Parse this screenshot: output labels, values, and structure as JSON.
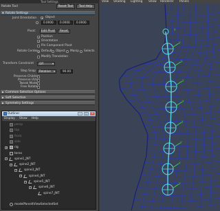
{
  "tool_settings": {
    "window_title": "Tool Settings",
    "tool_name": "Rotate Tool",
    "reset_tool": "Reset Tool",
    "tool_help": "Tool Help",
    "sections": {
      "rotate_settings": "Rotate Settings",
      "common_selection": "Common Selection Options",
      "soft_selection": "Soft Selection",
      "symmetry_settings": "Symmetry Settings"
    },
    "joint_orientation_label": "Joint Orientation",
    "joint_orientation_value": "Object",
    "xyz_values": [
      "0.0000",
      "0.0000",
      "0.0000"
    ],
    "pivot_label": "Pivot:",
    "edit_pivot": "Edit Pivot",
    "reset": "Reset",
    "position_label": "Position",
    "orientation_label": "Orientation",
    "pin_pivot_label": "Pin Component Pivot",
    "rotate_center_label": "Rotate Center",
    "rotate_center_options": [
      "Default",
      "Object",
      "Manip",
      "Selects"
    ],
    "modify_translation_label": "Modify Translation",
    "transform_constraint_label": "Transform Constraint",
    "transform_constraint_value": "Off",
    "step_snap_label": "Step Snap",
    "step_snap_mode": "Relative",
    "step_snap_value": "90.00",
    "preserve_children_label": "Preserve Children",
    "preserve_uvs_label": "Preserve UVs",
    "tweak_mode_label": "Tweak Mode",
    "free_rotate_label": "Free Rotate"
  },
  "outliner": {
    "title": "Outliner",
    "menu": [
      "Display",
      "Show",
      "Help"
    ],
    "win_buttons": [
      "–",
      "□",
      "✕"
    ],
    "items": [
      {
        "label": "persp",
        "depth": 0,
        "dim": true,
        "icon": "camera-icon"
      },
      {
        "label": "top",
        "depth": 0,
        "dim": true,
        "icon": "camera-icon"
      },
      {
        "label": "front",
        "depth": 0,
        "dim": true,
        "icon": "camera-icon"
      },
      {
        "label": "side",
        "depth": 0,
        "dim": true,
        "icon": "camera-icon"
      },
      {
        "label": "rig",
        "depth": 0,
        "dim": false,
        "icon": "group-icon",
        "exp": "+"
      },
      {
        "label": "torso",
        "depth": 0,
        "dim": false,
        "icon": "mesh-icon",
        "exp": ""
      },
      {
        "label": "spine1_JNT",
        "depth": 0,
        "dim": false,
        "icon": "joint-icon",
        "exp": "−"
      },
      {
        "label": "spine2_JNT",
        "depth": 1,
        "dim": false,
        "icon": "joint-icon",
        "exp": "−"
      },
      {
        "label": "spine3_JNT",
        "depth": 2,
        "dim": false,
        "icon": "joint-icon",
        "exp": "−"
      },
      {
        "label": "spine4_JNT",
        "depth": 3,
        "dim": false,
        "icon": "joint-icon",
        "exp": "−"
      },
      {
        "label": "spine5_JNT",
        "depth": 4,
        "dim": false,
        "icon": "joint-icon",
        "exp": "−"
      },
      {
        "label": "spine6_JNT",
        "depth": 5,
        "dim": false,
        "icon": "joint-icon",
        "exp": "−"
      },
      {
        "label": "spine7_JNT",
        "depth": 6,
        "dim": false,
        "icon": "joint-icon",
        "exp": ""
      },
      {
        "label": "",
        "depth": 0,
        "dim": false,
        "icon": "",
        "exp": ""
      },
      {
        "label": "modelPanel4ViewSelectedSet",
        "depth": 0,
        "dim": false,
        "icon": "set-icon",
        "exp": ""
      }
    ]
  },
  "viewport": {
    "menu": [
      "View",
      "Shading",
      "Lighting",
      "Show",
      "Renderer",
      "Panels"
    ],
    "colors": {
      "background": "#3a4456",
      "wireframe": "#2b39a8",
      "joints": "#58d6e6",
      "handles": "#3fd23f"
    }
  }
}
